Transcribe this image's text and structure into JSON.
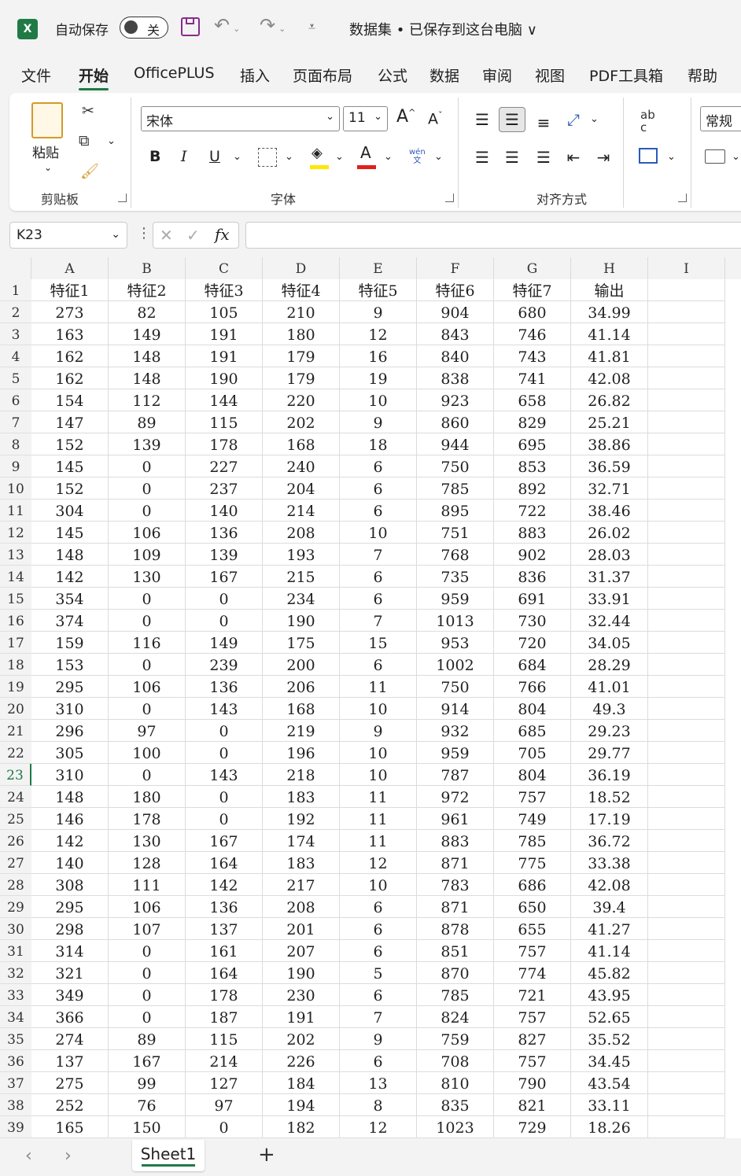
{
  "titlebar": {
    "app_icon": "X",
    "autosave_label": "自动保存",
    "autosave_state": "关",
    "doc_title": "数据集 • 已保存到这台电脑 ∨"
  },
  "tabs": [
    "文件",
    "开始",
    "OfficePLUS",
    "插入",
    "页面布局",
    "公式",
    "数据",
    "审阅",
    "视图",
    "PDF工具箱",
    "帮助"
  ],
  "active_tab": "开始",
  "ribbon": {
    "clipboard": {
      "paste_label": "粘贴",
      "group_label": "剪贴板"
    },
    "font": {
      "font_name": "宋体",
      "font_size": "11",
      "bold": "B",
      "italic": "I",
      "underline": "U",
      "font_color_letter": "A",
      "grow": "A",
      "shrink": "A",
      "phonetic_top": "wén",
      "phonetic_bottom": "文",
      "group_label": "字体"
    },
    "alignment": {
      "group_label": "对齐方式",
      "wrap": "ab",
      "wrap2": "c"
    },
    "number": {
      "format": "常规"
    }
  },
  "formula_bar": {
    "name_box": "K23",
    "fx": "fx",
    "value": ""
  },
  "grid": {
    "columns": [
      "A",
      "B",
      "C",
      "D",
      "E",
      "F",
      "G",
      "H",
      "I"
    ],
    "selected_row": 23,
    "rows": [
      [
        "特征1",
        "特征2",
        "特征3",
        "特征4",
        "特征5",
        "特征6",
        "特征7",
        "输出"
      ],
      [
        "273",
        "82",
        "105",
        "210",
        "9",
        "904",
        "680",
        "34.99"
      ],
      [
        "163",
        "149",
        "191",
        "180",
        "12",
        "843",
        "746",
        "41.14"
      ],
      [
        "162",
        "148",
        "191",
        "179",
        "16",
        "840",
        "743",
        "41.81"
      ],
      [
        "162",
        "148",
        "190",
        "179",
        "19",
        "838",
        "741",
        "42.08"
      ],
      [
        "154",
        "112",
        "144",
        "220",
        "10",
        "923",
        "658",
        "26.82"
      ],
      [
        "147",
        "89",
        "115",
        "202",
        "9",
        "860",
        "829",
        "25.21"
      ],
      [
        "152",
        "139",
        "178",
        "168",
        "18",
        "944",
        "695",
        "38.86"
      ],
      [
        "145",
        "0",
        "227",
        "240",
        "6",
        "750",
        "853",
        "36.59"
      ],
      [
        "152",
        "0",
        "237",
        "204",
        "6",
        "785",
        "892",
        "32.71"
      ],
      [
        "304",
        "0",
        "140",
        "214",
        "6",
        "895",
        "722",
        "38.46"
      ],
      [
        "145",
        "106",
        "136",
        "208",
        "10",
        "751",
        "883",
        "26.02"
      ],
      [
        "148",
        "109",
        "139",
        "193",
        "7",
        "768",
        "902",
        "28.03"
      ],
      [
        "142",
        "130",
        "167",
        "215",
        "6",
        "735",
        "836",
        "31.37"
      ],
      [
        "354",
        "0",
        "0",
        "234",
        "6",
        "959",
        "691",
        "33.91"
      ],
      [
        "374",
        "0",
        "0",
        "190",
        "7",
        "1013",
        "730",
        "32.44"
      ],
      [
        "159",
        "116",
        "149",
        "175",
        "15",
        "953",
        "720",
        "34.05"
      ],
      [
        "153",
        "0",
        "239",
        "200",
        "6",
        "1002",
        "684",
        "28.29"
      ],
      [
        "295",
        "106",
        "136",
        "206",
        "11",
        "750",
        "766",
        "41.01"
      ],
      [
        "310",
        "0",
        "143",
        "168",
        "10",
        "914",
        "804",
        "49.3"
      ],
      [
        "296",
        "97",
        "0",
        "219",
        "9",
        "932",
        "685",
        "29.23"
      ],
      [
        "305",
        "100",
        "0",
        "196",
        "10",
        "959",
        "705",
        "29.77"
      ],
      [
        "310",
        "0",
        "143",
        "218",
        "10",
        "787",
        "804",
        "36.19"
      ],
      [
        "148",
        "180",
        "0",
        "183",
        "11",
        "972",
        "757",
        "18.52"
      ],
      [
        "146",
        "178",
        "0",
        "192",
        "11",
        "961",
        "749",
        "17.19"
      ],
      [
        "142",
        "130",
        "167",
        "174",
        "11",
        "883",
        "785",
        "36.72"
      ],
      [
        "140",
        "128",
        "164",
        "183",
        "12",
        "871",
        "775",
        "33.38"
      ],
      [
        "308",
        "111",
        "142",
        "217",
        "10",
        "783",
        "686",
        "42.08"
      ],
      [
        "295",
        "106",
        "136",
        "208",
        "6",
        "871",
        "650",
        "39.4"
      ],
      [
        "298",
        "107",
        "137",
        "201",
        "6",
        "878",
        "655",
        "41.27"
      ],
      [
        "314",
        "0",
        "161",
        "207",
        "6",
        "851",
        "757",
        "41.14"
      ],
      [
        "321",
        "0",
        "164",
        "190",
        "5",
        "870",
        "774",
        "45.82"
      ],
      [
        "349",
        "0",
        "178",
        "230",
        "6",
        "785",
        "721",
        "43.95"
      ],
      [
        "366",
        "0",
        "187",
        "191",
        "7",
        "824",
        "757",
        "52.65"
      ],
      [
        "274",
        "89",
        "115",
        "202",
        "9",
        "759",
        "827",
        "35.52"
      ],
      [
        "137",
        "167",
        "214",
        "226",
        "6",
        "708",
        "757",
        "34.45"
      ],
      [
        "275",
        "99",
        "127",
        "184",
        "13",
        "810",
        "790",
        "43.54"
      ],
      [
        "252",
        "76",
        "97",
        "194",
        "8",
        "835",
        "821",
        "33.11"
      ],
      [
        "165",
        "150",
        "0",
        "182",
        "12",
        "1023",
        "729",
        "18.26"
      ]
    ]
  },
  "sheets": {
    "active": "Sheet1",
    "add": "+"
  },
  "colors": {
    "accent": "#1e7a45",
    "save_icon": "#8a2a8f",
    "highlight": "#ffe800",
    "font_red": "#e0201b"
  }
}
